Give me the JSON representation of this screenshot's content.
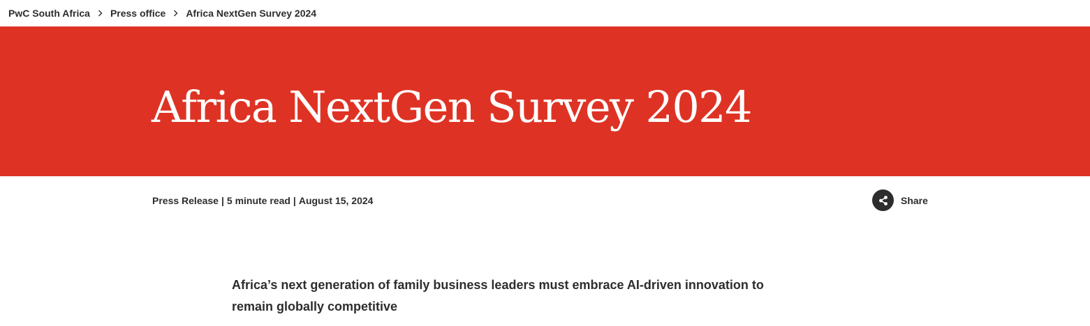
{
  "breadcrumb": {
    "items": [
      {
        "label": "PwC South Africa"
      },
      {
        "label": "Press office"
      },
      {
        "label": "Africa NextGen Survey 2024"
      }
    ]
  },
  "hero": {
    "title": "Africa NextGen Survey 2024",
    "background_color": "#de3324"
  },
  "meta": {
    "type": "Press Release",
    "read_time": "5 minute read",
    "date": "August 15, 2024",
    "separator": "|"
  },
  "share": {
    "label": "Share",
    "icon": "share-icon"
  },
  "article": {
    "lead": "Africa’s next generation of family business leaders must embrace AI-driven innovation to remain globally competitive"
  }
}
